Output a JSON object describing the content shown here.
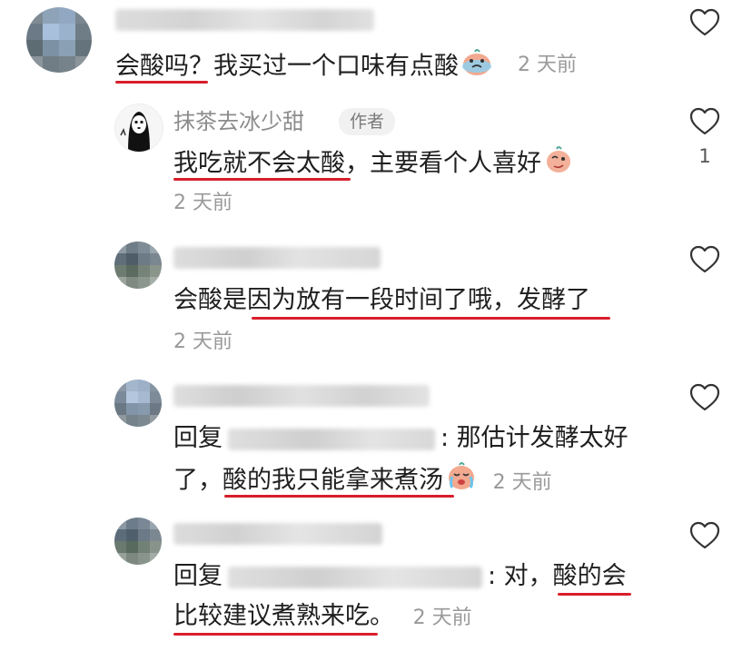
{
  "comments": [
    {
      "text": "会酸吗？我买过一个口味有点酸",
      "time": "2 天前"
    },
    {
      "author": "抹茶去冰少甜",
      "badge": "作者",
      "text": "我吃就不会太酸，主要看个人喜好",
      "time": "2 天前",
      "likes": "1"
    },
    {
      "text": "会酸是因为放有一段时间了哦，发酵了",
      "time": "2 天前"
    },
    {
      "reply_prefix": "回复",
      "line1_tail": ": 那估计发酵太好",
      "line2": "了，酸的我只能拿来煮汤",
      "time": "2 天前"
    },
    {
      "reply_prefix": "回复",
      "line1_tail": ": 对，酸的会",
      "line2": "比较建议煮熟来吃。",
      "time": "2 天前"
    }
  ],
  "colors": {
    "underline": "#d81e2a",
    "muted": "#999999"
  },
  "icons": [
    "heart-icon",
    "crying-emoji-icon",
    "thinking-emoji-icon",
    "avatar-icon"
  ]
}
